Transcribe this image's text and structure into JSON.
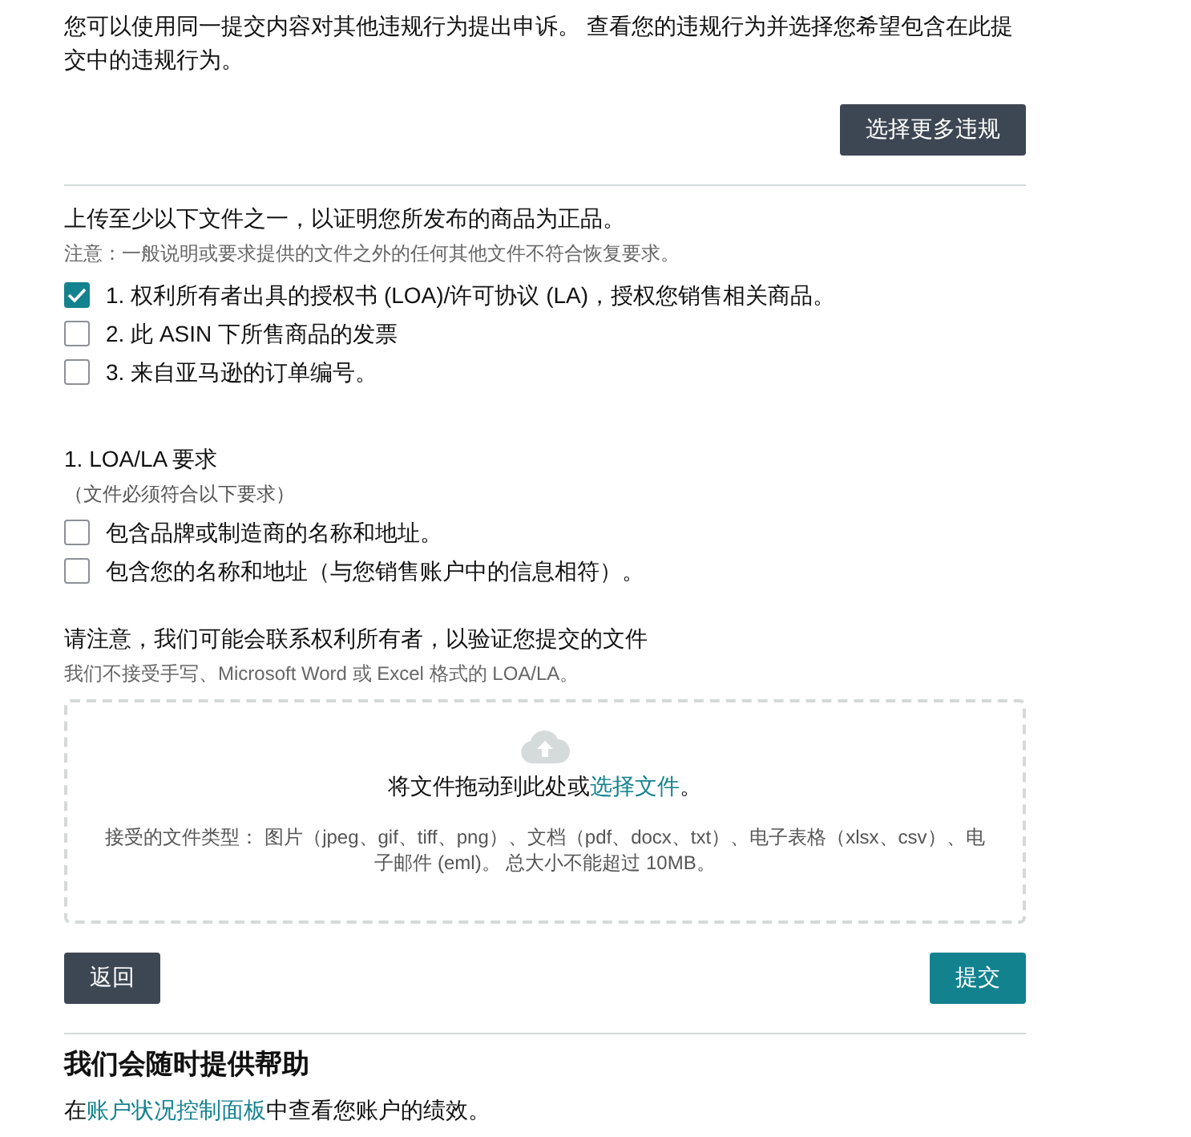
{
  "intro": "您可以使用同一提交内容对其他违规行为提出申诉。 查看您的违规行为并选择您希望包含在此提交中的违规行为。",
  "select_more_button": "选择更多违规",
  "upload_heading": "上传至少以下文件之一，以证明您所发布的商品为正品。",
  "upload_note": "注意：一般说明或要求提供的文件之外的任何其他文件不符合恢复要求。",
  "document_options": [
    {
      "label": "1. 权利所有者出具的授权书 (LOA)/许可协议 (LA)，授权您销售相关商品。",
      "checked": true
    },
    {
      "label": "2. 此 ASIN 下所售商品的发票",
      "checked": false
    },
    {
      "label": "3. 来自亚马逊的订单编号。",
      "checked": false
    }
  ],
  "requirements": {
    "title": "1. LOA/LA 要求",
    "subtitle": "（文件必须符合以下要求）",
    "items": [
      {
        "label": "包含品牌或制造商的名称和地址。",
        "checked": false
      },
      {
        "label": "包含您的名称和地址（与您销售账户中的信息相符）。",
        "checked": false
      }
    ]
  },
  "verify_note": "请注意，我们可能会联系权利所有者，以验证您提交的文件",
  "format_note": "我们不接受手写、Microsoft Word 或 Excel 格式的 LOA/LA。",
  "dropzone": {
    "text_before": "将文件拖动到此处或",
    "link": "选择文件",
    "text_after": "。",
    "accepted": "接受的文件类型： 图片（jpeg、gif、tiff、png）、文档（pdf、docx、txt）、电子表格（xlsx、csv）、电子邮件 (eml)。 总大小不能超过 10MB。"
  },
  "back_button": "返回",
  "submit_button": "提交",
  "help": {
    "heading": "我们会随时提供帮助",
    "text_before": "在",
    "link": "账户状况控制面板",
    "text_after": "中查看您账户的绩效。"
  }
}
